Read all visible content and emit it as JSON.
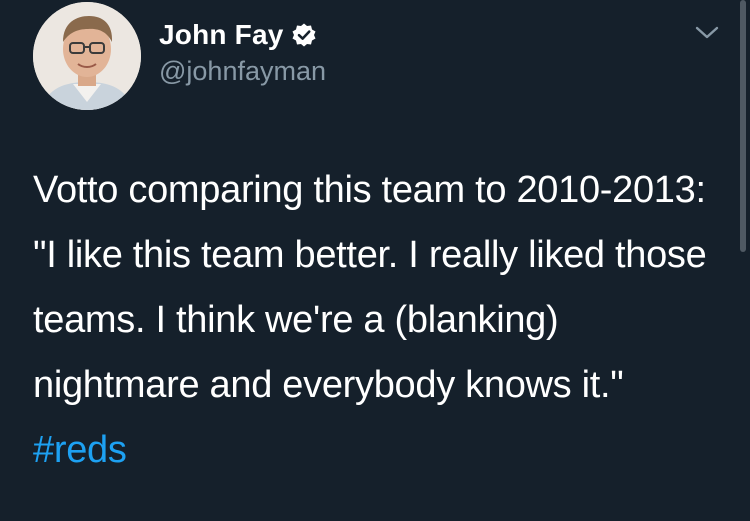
{
  "author": {
    "display_name": "John Fay",
    "handle": "@johnfayman",
    "verified": true,
    "avatar_icon": "profile-photo"
  },
  "tweet": {
    "text": "Votto comparing this team to 2010-2013: \"I like this team better. I really liked those teams. I think we're a (blanking) nightmare and everybody knows it.\" ",
    "hashtag": "#reds"
  },
  "icons": {
    "verified": "verified-badge-icon",
    "menu": "chevron-down-icon"
  },
  "colors": {
    "background": "#15202b",
    "text": "#ffffff",
    "secondary_text": "#8899a6",
    "hashtag": "#1da1f2"
  }
}
